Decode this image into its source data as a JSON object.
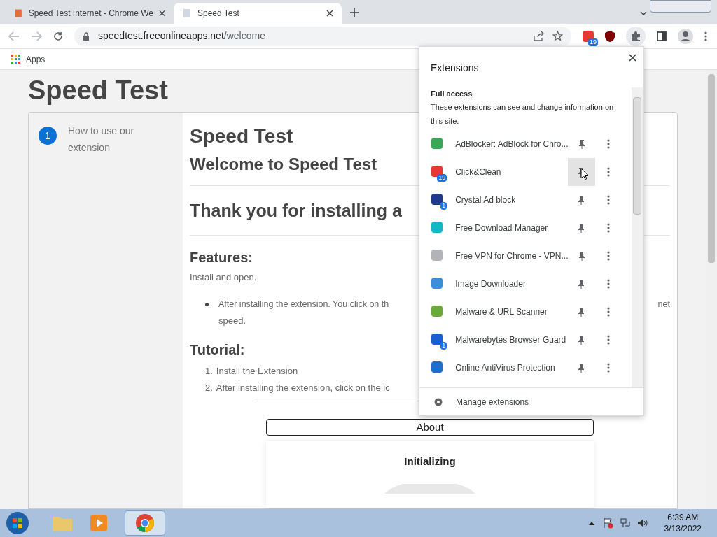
{
  "browser": {
    "tabs": [
      {
        "title": "Speed Test Internet - Chrome We",
        "selected": false
      },
      {
        "title": "Speed Test",
        "selected": true
      }
    ],
    "address": {
      "host": "speedtest.freeonlineapps.net",
      "path": "/welcome"
    },
    "bookmarks": [
      {
        "label": "Apps"
      }
    ],
    "toolbar_badge": "19"
  },
  "page": {
    "title": "Speed Test",
    "steps": [
      {
        "number": "1",
        "label": "How to use our extension"
      }
    ],
    "heading": "Speed Test",
    "subheading": "Welcome to Speed Test",
    "thanks": "Thank you for installing a",
    "features_title": "Features:",
    "features_intro": "Install and open.",
    "features_bullet": "After installing the extension. You click on th",
    "features_bullet_end": "net",
    "features_bullet_line2": "speed.",
    "tutorial_title": "Tutorial:",
    "tutorial_steps": [
      {
        "number": "1.",
        "text": "Install the Extension"
      },
      {
        "number": "2.",
        "text": "After installing the extension, click on the ic"
      }
    ],
    "about_button": "About",
    "status": "Initializing"
  },
  "extensions_popup": {
    "title": "Extensions",
    "section": "Full access",
    "description": "These extensions can see and change information on this site.",
    "items": [
      {
        "name": "AdBlocker: AdBlock for Chro...",
        "color": "#3aa757",
        "hovered": false
      },
      {
        "name": "Click&Clean",
        "color": "#e53935",
        "badge": "19",
        "hovered": true
      },
      {
        "name": "Crystal Ad block",
        "color": "#1e3a8a",
        "badge": "1",
        "hovered": false
      },
      {
        "name": "Free Download Manager",
        "color": "#14b8c4",
        "hovered": false
      },
      {
        "name": "Free VPN for Chrome - VPN...",
        "color": "#b0b4b8",
        "hovered": false
      },
      {
        "name": "Image Downloader",
        "color": "#3b8fd9",
        "hovered": false
      },
      {
        "name": "Malware & URL Scanner",
        "color": "#6aaa3a",
        "hovered": false
      },
      {
        "name": "Malwarebytes Browser Guard",
        "color": "#1a5fd0",
        "badge": "1",
        "hovered": false
      },
      {
        "name": "Online AntiVirus Protection",
        "color": "#1f6fd1",
        "hovered": false
      }
    ],
    "manage": "Manage extensions"
  },
  "taskbar": {
    "time": "6:39 AM",
    "date": "3/13/2022"
  }
}
